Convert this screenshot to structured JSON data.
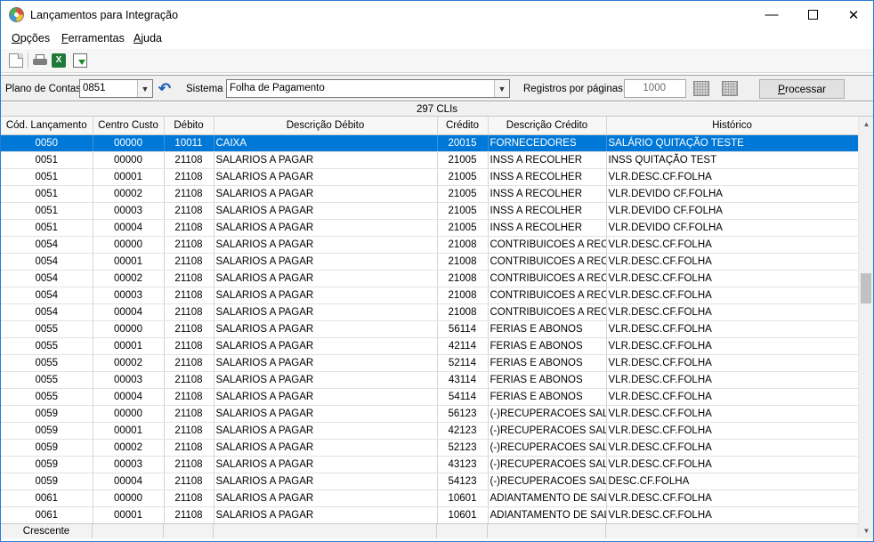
{
  "window": {
    "title": "Lançamentos para Integração",
    "controls": {
      "minimize": "—",
      "close": "✕"
    }
  },
  "menu": {
    "items": [
      {
        "u": "O",
        "rest": "pções"
      },
      {
        "u": "F",
        "rest": "erramentas"
      },
      {
        "u": "A",
        "rest": "juda"
      }
    ]
  },
  "toolbar": {
    "icons": [
      "new-document-icon",
      "print-icon",
      "excel-icon",
      "export-icon"
    ],
    "excel_glyph": "X"
  },
  "filters": {
    "plano_label": "Plano de Contas",
    "plano_value": "0851",
    "sistema_label": "Sistema",
    "sistema_value": "Folha de Pagamento",
    "registros_label": "Registros por páginas:",
    "registros_value": "1000",
    "process_button": {
      "u": "P",
      "rest": "rocessar"
    }
  },
  "grid": {
    "count_label": "297 CLIs",
    "columns": [
      "Cód. Lançamento",
      "Centro Custo",
      "Débito",
      "Descrição Débito",
      "Crédito",
      "Descrição Crédito",
      "Histórico"
    ],
    "selected_row": 0,
    "rows": [
      [
        "0050",
        "00000",
        "10011",
        "CAIXA",
        "20015",
        "FORNECEDORES",
        "SALÁRIO QUITAÇÃO TESTE"
      ],
      [
        "0051",
        "00000",
        "21108",
        "SALARIOS A PAGAR",
        "21005",
        "INSS A RECOLHER",
        "INSS QUITAÇÃO TEST"
      ],
      [
        "0051",
        "00001",
        "21108",
        "SALARIOS A PAGAR",
        "21005",
        "INSS A RECOLHER",
        "VLR.DESC.CF.FOLHA"
      ],
      [
        "0051",
        "00002",
        "21108",
        "SALARIOS A PAGAR",
        "21005",
        "INSS A RECOLHER",
        "VLR.DEVIDO CF.FOLHA"
      ],
      [
        "0051",
        "00003",
        "21108",
        "SALARIOS A PAGAR",
        "21005",
        "INSS A RECOLHER",
        "VLR.DEVIDO CF.FOLHA"
      ],
      [
        "0051",
        "00004",
        "21108",
        "SALARIOS A PAGAR",
        "21005",
        "INSS A RECOLHER",
        "VLR.DEVIDO CF.FOLHA"
      ],
      [
        "0054",
        "00000",
        "21108",
        "SALARIOS A PAGAR",
        "21008",
        "CONTRIBUICOES A RECOL",
        "VLR.DESC.CF.FOLHA"
      ],
      [
        "0054",
        "00001",
        "21108",
        "SALARIOS A PAGAR",
        "21008",
        "CONTRIBUICOES A RECOL",
        "VLR.DESC.CF.FOLHA"
      ],
      [
        "0054",
        "00002",
        "21108",
        "SALARIOS A PAGAR",
        "21008",
        "CONTRIBUICOES A RECOL",
        "VLR.DESC.CF.FOLHA"
      ],
      [
        "0054",
        "00003",
        "21108",
        "SALARIOS A PAGAR",
        "21008",
        "CONTRIBUICOES A RECOL",
        "VLR.DESC.CF.FOLHA"
      ],
      [
        "0054",
        "00004",
        "21108",
        "SALARIOS A PAGAR",
        "21008",
        "CONTRIBUICOES A RECOL",
        "VLR.DESC.CF.FOLHA"
      ],
      [
        "0055",
        "00000",
        "21108",
        "SALARIOS A PAGAR",
        "56114",
        "FERIAS E ABONOS",
        "VLR.DESC.CF.FOLHA"
      ],
      [
        "0055",
        "00001",
        "21108",
        "SALARIOS A PAGAR",
        "42114",
        "FERIAS E ABONOS",
        "VLR.DESC.CF.FOLHA"
      ],
      [
        "0055",
        "00002",
        "21108",
        "SALARIOS A PAGAR",
        "52114",
        "FERIAS E ABONOS",
        "VLR.DESC.CF.FOLHA"
      ],
      [
        "0055",
        "00003",
        "21108",
        "SALARIOS A PAGAR",
        "43114",
        "FERIAS E ABONOS",
        "VLR.DESC.CF.FOLHA"
      ],
      [
        "0055",
        "00004",
        "21108",
        "SALARIOS A PAGAR",
        "54114",
        "FERIAS E ABONOS",
        "VLR.DESC.CF.FOLHA"
      ],
      [
        "0059",
        "00000",
        "21108",
        "SALARIOS A PAGAR",
        "56123",
        "(-)RECUPERACOES SALARI",
        "VLR.DESC.CF.FOLHA"
      ],
      [
        "0059",
        "00001",
        "21108",
        "SALARIOS A PAGAR",
        "42123",
        "(-)RECUPERACOES SALARI",
        "VLR.DESC.CF.FOLHA"
      ],
      [
        "0059",
        "00002",
        "21108",
        "SALARIOS A PAGAR",
        "52123",
        "(-)RECUPERACOES SALARI",
        "VLR.DESC.CF.FOLHA"
      ],
      [
        "0059",
        "00003",
        "21108",
        "SALARIOS A PAGAR",
        "43123",
        "(-)RECUPERACOES SALARI",
        "VLR.DESC.CF.FOLHA"
      ],
      [
        "0059",
        "00004",
        "21108",
        "SALARIOS A PAGAR",
        "54123",
        "(-)RECUPERACOES SALARI",
        "DESC.CF.FOLHA"
      ],
      [
        "0061",
        "00000",
        "21108",
        "SALARIOS A PAGAR",
        "10601",
        "ADIANTAMENTO DE SALAR",
        "VLR.DESC.CF.FOLHA"
      ],
      [
        "0061",
        "00001",
        "21108",
        "SALARIOS A PAGAR",
        "10601",
        "ADIANTAMENTO DE SALAR",
        "VLR.DESC.CF.FOLHA"
      ]
    ],
    "footer_sort": "Crescente"
  },
  "colors": {
    "selection": "#0078d7",
    "window_border": "#2b7cd3"
  }
}
